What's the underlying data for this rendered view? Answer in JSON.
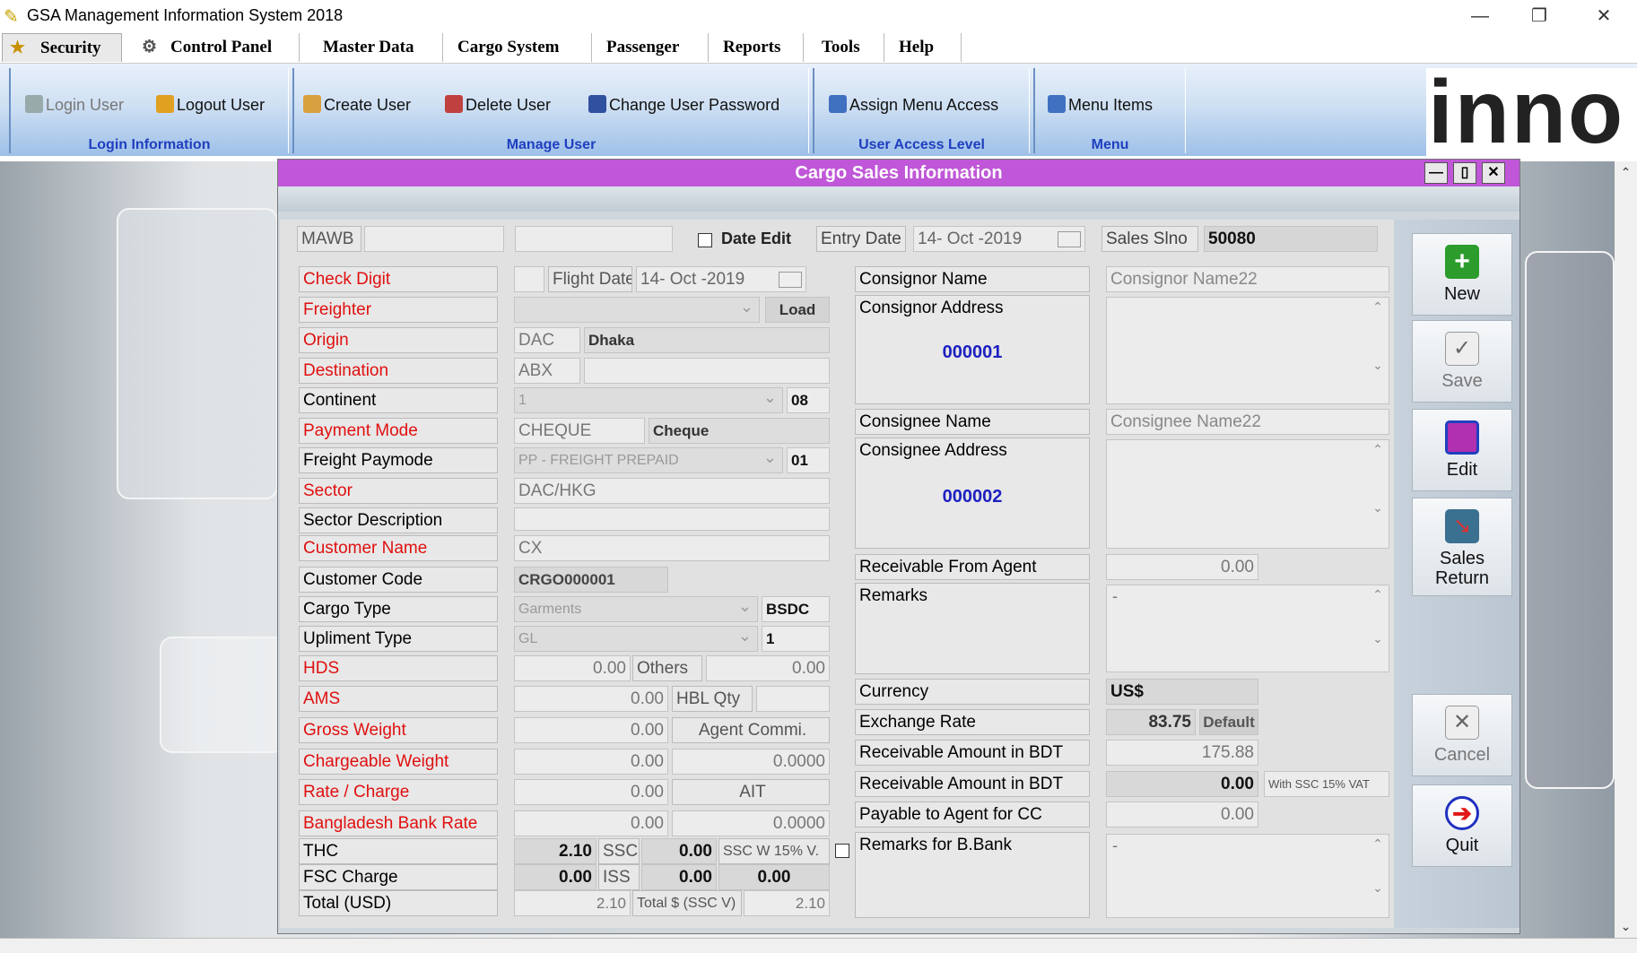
{
  "window": {
    "title": "GSA Management Information System 2018",
    "minimize": "—",
    "maximize": "❐",
    "close": "✕"
  },
  "menu": [
    "Security",
    "Control Panel",
    "Master Data",
    "Cargo System",
    "Passenger",
    "Reports",
    "Tools",
    "Help"
  ],
  "ribbon": {
    "groups": [
      {
        "label": "Login Information",
        "buttons": [
          "Login User",
          "Logout User"
        ]
      },
      {
        "label": "Manage User",
        "buttons": [
          "Create User",
          "Delete User",
          "Change User Password"
        ]
      },
      {
        "label": "User Access Level",
        "buttons": [
          "Assign Menu Access"
        ]
      },
      {
        "label": "Menu",
        "buttons": [
          "Menu Items"
        ]
      }
    ],
    "logo_text": "inno"
  },
  "child": {
    "title": "Cargo Sales Information",
    "minimize": "—",
    "restore": "▯",
    "close": "✕"
  },
  "top": {
    "mawb_label": "MAWB",
    "mawb_value": "",
    "mawb_value2": "",
    "date_edit_label": "Date Edit",
    "entry_date_label": "Entry Date",
    "entry_date": "14- Oct -2019",
    "sales_slno_label": "Sales Slno",
    "sales_slno": "50080"
  },
  "left": {
    "check_digit": "Check Digit",
    "flight_date_label": "Flight Date",
    "flight_date": "14- Oct -2019",
    "freighter": "Freighter",
    "load": "Load",
    "origin": "Origin",
    "origin_code": "DAC",
    "origin_name": "Dhaka",
    "destination": "Destination",
    "dest_code": "ABX",
    "continent": "Continent",
    "continent_value": "1",
    "continent_code": "08",
    "payment_mode": "Payment Mode",
    "payment_value": "CHEQUE",
    "payment_name": "Cheque",
    "freight_paymode": "Freight Paymode",
    "freight_value": "PP - FREIGHT PREPAID",
    "freight_code": "01",
    "sector": "Sector",
    "sector_value": "DAC/HKG",
    "sector_desc": "Sector Description",
    "customer_name": "Customer Name",
    "customer_value": "CX",
    "customer_code": "Customer Code",
    "customer_code_value": "CRGO000001",
    "cargo_type": "Cargo Type",
    "cargo_type_value": "Garments",
    "cargo_type_code": "BSDC",
    "upliment_type": "Upliment Type",
    "upliment_value": "GL",
    "upliment_code": "1",
    "hds": "HDS",
    "hds_value": "0.00",
    "others_label": "Others",
    "others_value": "0.00",
    "ams": "AMS",
    "ams_value": "0.00",
    "hbl_label": "HBL Qty",
    "gross_weight": "Gross Weight",
    "gross_value": "0.00",
    "agent_commi": "Agent Commi.",
    "chargeable_weight": "Chargeable Weight",
    "chargeable_value": "0.00",
    "chargeable_right": "0.0000",
    "rate_charge": "Rate / Charge",
    "rate_value": "0.00",
    "ait": "AIT",
    "bb_rate": "Bangladesh Bank Rate",
    "bb_value": "0.00",
    "bb_right": "0.0000",
    "thc": "THC",
    "thc_value": "2.10",
    "ssc_label": "SSC",
    "ssc_value": "0.00",
    "sscw_label": "SSC W 15% V.",
    "fsc": "FSC Charge",
    "fsc_value": "0.00",
    "iss_label": "ISS",
    "iss_value": "0.00",
    "iss_right": "0.00",
    "total": "Total (USD)",
    "total_value": "2.10",
    "total_ssc_label": "Total $ (SSC V)",
    "total_ssc_value": "2.10"
  },
  "right": {
    "consignor_name": "Consignor Name",
    "consignor_name_value": "Consignor Name22",
    "consignor_address": "Consignor Address",
    "consignor_code": "000001",
    "consignee_name": "Consignee Name",
    "consignee_name_value": "Consignee Name22",
    "consignee_address": "Consignee Address",
    "consignee_code": "000002",
    "receivable_agent": "Receivable From Agent",
    "receivable_agent_value": "0.00",
    "remarks": "Remarks",
    "remarks_value": "-",
    "currency": "Currency",
    "currency_value": "US$",
    "exchange_rate": "Exchange Rate",
    "exchange_value": "83.75",
    "default_btn": "Default",
    "recv_bdt": "Receivable Amount in BDT",
    "recv_bdt_value": "175.88",
    "recv_bdt2": "Receivable Amount in BDT",
    "recv_bdt2_value": "0.00",
    "with_ssc": "With SSC 15% VAT",
    "payable_cc": "Payable to Agent for CC",
    "payable_cc_value": "0.00",
    "remarks_bb": "Remarks for B.Bank",
    "remarks_bb_value": "-"
  },
  "actions": {
    "new": "New",
    "save": "Save",
    "edit": "Edit",
    "sales_return_1": "Sales",
    "sales_return_2": "Return",
    "cancel": "Cancel",
    "quit": "Quit"
  }
}
